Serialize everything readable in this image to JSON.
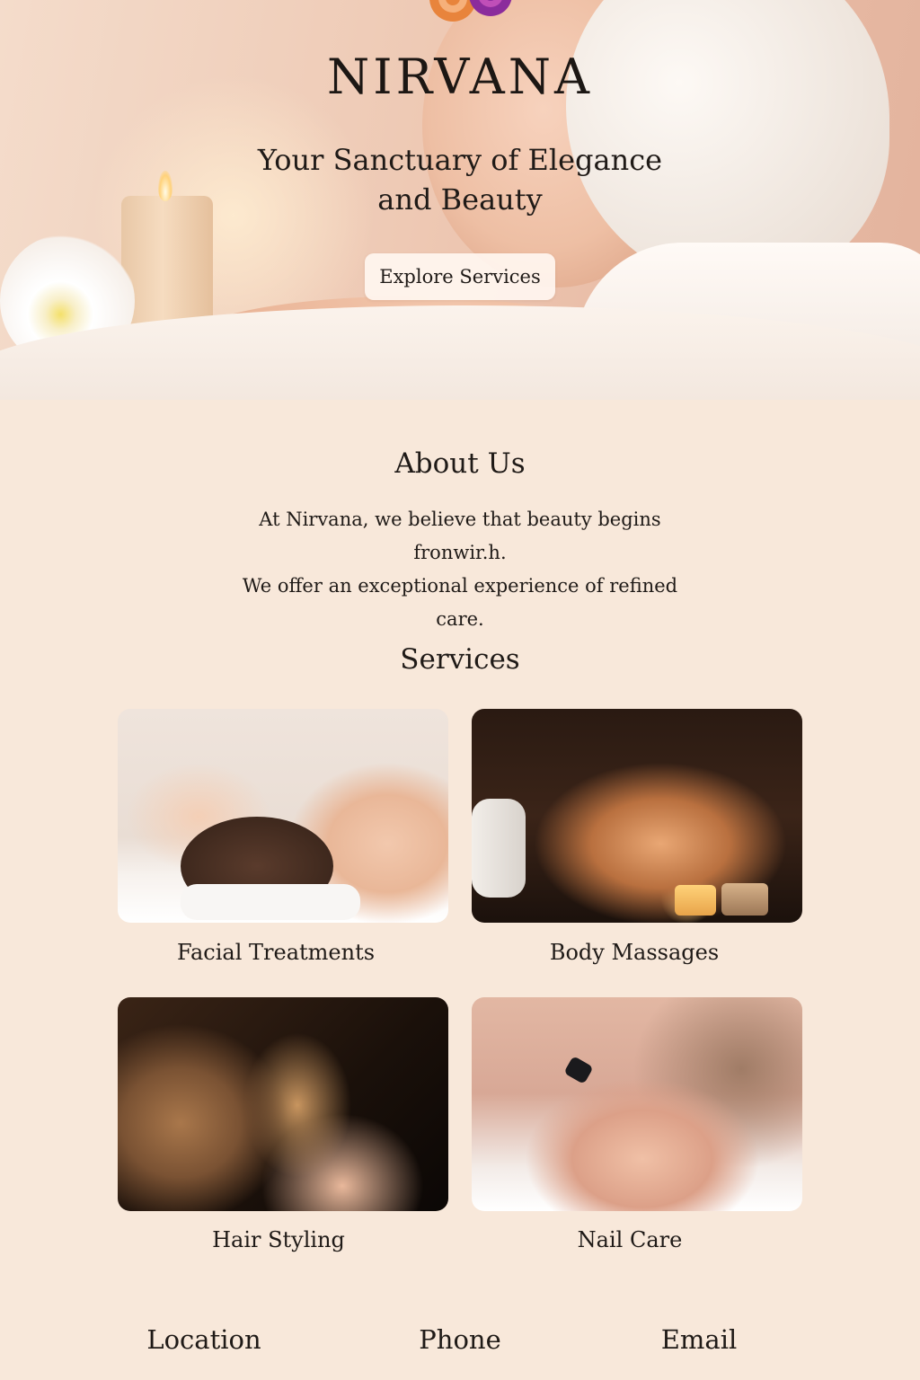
{
  "hero": {
    "brand": "NIRVANA",
    "tagline_line1": "Your Sanctuary of Elegance",
    "tagline_line2": "and Beauty",
    "cta_label": "Explore Services"
  },
  "about": {
    "title": "About Us",
    "text_line1": "At Nirvana, we believe that beauty begins fronwir.h.",
    "text_line2": "We offer an exceptional experience of refined",
    "text_line3": "care."
  },
  "services": {
    "title": "Services",
    "items": [
      {
        "label": "Facial Treatments"
      },
      {
        "label": "Body Massages"
      },
      {
        "label": "Hair Styling"
      },
      {
        "label": "Nail Care"
      }
    ]
  },
  "footer": {
    "location_label": "Location",
    "phone_label": "Phone",
    "email_label": "Email"
  },
  "colors": {
    "background": "#f8e8da",
    "button_bg": "#fff6f0",
    "logo_orange": "#e8843c",
    "logo_purple": "#8b2c9c"
  }
}
